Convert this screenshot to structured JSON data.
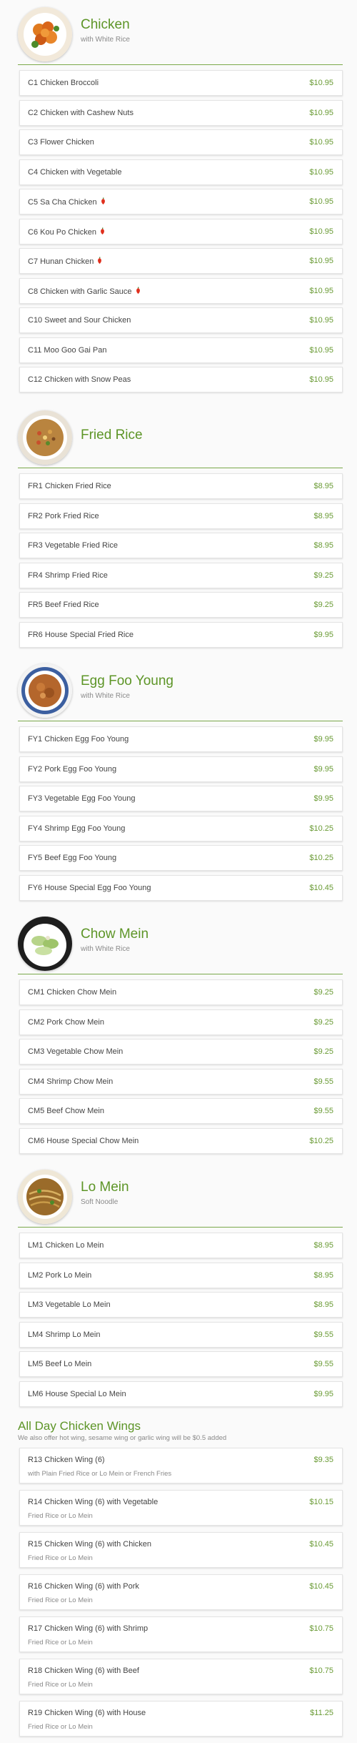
{
  "colors": {
    "accent": "#5d9527",
    "price": "#6a9b35",
    "background": "#fafafa"
  },
  "sections": [
    {
      "key": "chicken",
      "title": "Chicken",
      "subtitle": "with White Rice",
      "image_icon": "chicken-dish-photo",
      "items": [
        {
          "name": "C1 Chicken Broccoli",
          "price": "$10.95",
          "spicy": false
        },
        {
          "name": "C2 Chicken with Cashew Nuts",
          "price": "$10.95",
          "spicy": false
        },
        {
          "name": "C3 Flower Chicken",
          "price": "$10.95",
          "spicy": false
        },
        {
          "name": "C4 Chicken with Vegetable",
          "price": "$10.95",
          "spicy": false
        },
        {
          "name": "C5 Sa Cha Chicken",
          "price": "$10.95",
          "spicy": true
        },
        {
          "name": "C6 Kou Po Chicken",
          "price": "$10.95",
          "spicy": true
        },
        {
          "name": "C7 Hunan Chicken",
          "price": "$10.95",
          "spicy": true
        },
        {
          "name": "C8 Chicken with Garlic Sauce",
          "price": "$10.95",
          "spicy": true
        },
        {
          "name": "C10 Sweet and Sour Chicken",
          "price": "$10.95",
          "spicy": false
        },
        {
          "name": "C11 Moo Goo Gai Pan",
          "price": "$10.95",
          "spicy": false
        },
        {
          "name": "C12 Chicken with Snow Peas",
          "price": "$10.95",
          "spicy": false
        }
      ]
    },
    {
      "key": "fried-rice",
      "title": "Fried Rice",
      "subtitle": "",
      "image_icon": "fried-rice-photo",
      "items": [
        {
          "name": "FR1 Chicken Fried Rice",
          "price": "$8.95",
          "spicy": false
        },
        {
          "name": "FR2 Pork Fried Rice",
          "price": "$8.95",
          "spicy": false
        },
        {
          "name": "FR3 Vegetable Fried Rice",
          "price": "$8.95",
          "spicy": false
        },
        {
          "name": "FR4 Shrimp Fried Rice",
          "price": "$9.25",
          "spicy": false
        },
        {
          "name": "FR5 Beef Fried Rice",
          "price": "$9.25",
          "spicy": false
        },
        {
          "name": "FR6 House Special Fried Rice",
          "price": "$9.95",
          "spicy": false
        }
      ]
    },
    {
      "key": "egg-foo-young",
      "title": "Egg Foo Young",
      "subtitle": "with White Rice",
      "image_icon": "egg-foo-young-photo",
      "items": [
        {
          "name": "FY1 Chicken Egg Foo Young",
          "price": "$9.95",
          "spicy": false
        },
        {
          "name": "FY2 Pork Egg Foo Young",
          "price": "$9.95",
          "spicy": false
        },
        {
          "name": "FY3 Vegetable Egg Foo Young",
          "price": "$9.95",
          "spicy": false
        },
        {
          "name": "FY4 Shrimp Egg Foo Young",
          "price": "$10.25",
          "spicy": false
        },
        {
          "name": "FY5 Beef Egg Foo Young",
          "price": "$10.25",
          "spicy": false
        },
        {
          "name": "FY6 House Special Egg Foo Young",
          "price": "$10.45",
          "spicy": false
        }
      ]
    },
    {
      "key": "chow-mein",
      "title": "Chow Mein",
      "subtitle": "with White Rice",
      "image_icon": "chow-mein-photo",
      "items": [
        {
          "name": "CM1 Chicken Chow Mein",
          "price": "$9.25",
          "spicy": false
        },
        {
          "name": "CM2 Pork Chow Mein",
          "price": "$9.25",
          "spicy": false
        },
        {
          "name": "CM3 Vegetable Chow Mein",
          "price": "$9.25",
          "spicy": false
        },
        {
          "name": "CM4 Shrimp Chow Mein",
          "price": "$9.55",
          "spicy": false
        },
        {
          "name": "CM5 Beef Chow Mein",
          "price": "$9.55",
          "spicy": false
        },
        {
          "name": "CM6 House Special Chow Mein",
          "price": "$10.25",
          "spicy": false
        }
      ]
    },
    {
      "key": "lo-mein",
      "title": "Lo Mein",
      "subtitle": "Soft Noodle",
      "image_icon": "lo-mein-photo",
      "items": [
        {
          "name": "LM1 Chicken Lo Mein",
          "price": "$8.95",
          "spicy": false
        },
        {
          "name": "LM2 Pork Lo Mein",
          "price": "$8.95",
          "spicy": false
        },
        {
          "name": "LM3 Vegetable Lo Mein",
          "price": "$8.95",
          "spicy": false
        },
        {
          "name": "LM4 Shrimp Lo Mein",
          "price": "$9.55",
          "spicy": false
        },
        {
          "name": "LM5 Beef Lo Mein",
          "price": "$9.55",
          "spicy": false
        },
        {
          "name": "LM6 House Special Lo Mein",
          "price": "$9.95",
          "spicy": false
        }
      ]
    }
  ],
  "wings": {
    "title": "All Day Chicken Wings",
    "subtitle": "We also offer hot wing, sesame wing or garlic wing will be $0.5 added",
    "items": [
      {
        "name": "R13 Chicken Wing (6)",
        "price": "$9.35",
        "desc": "with Plain Fried Rice or Lo Mein or French Fries"
      },
      {
        "name": "R14 Chicken Wing (6) with Vegetable",
        "price": "$10.15",
        "desc": "Fried Rice or Lo Mein"
      },
      {
        "name": "R15 Chicken Wing (6) with Chicken",
        "price": "$10.45",
        "desc": "Fried Rice or Lo Mein"
      },
      {
        "name": "R16 Chicken Wing (6) with Pork",
        "price": "$10.45",
        "desc": "Fried Rice or Lo Mein"
      },
      {
        "name": "R17 Chicken Wing (6) with Shrimp",
        "price": "$10.75",
        "desc": "Fried Rice or Lo Mein"
      },
      {
        "name": "R18 Chicken Wing (6) with Beef",
        "price": "$10.75",
        "desc": "Fried Rice or Lo Mein"
      },
      {
        "name": "R19 Chicken Wing (6) with House",
        "price": "$11.25",
        "desc": "Fried Rice or Lo Mein"
      }
    ]
  }
}
